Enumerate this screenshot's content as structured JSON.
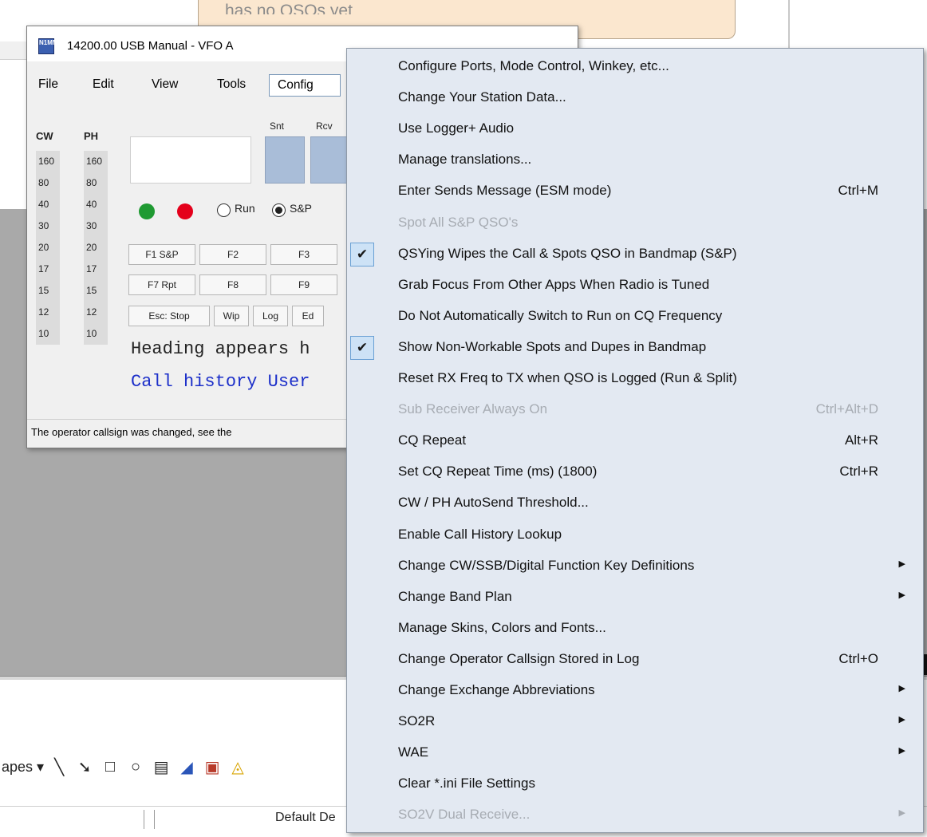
{
  "background": {
    "note_text": "has no QSOs yet",
    "draw_toolbar_label": "apes",
    "status_text": "Default De"
  },
  "entry_window": {
    "logo_text": "N1MM",
    "title": "14200.00 USB Manual - VFO A",
    "menus": [
      "File",
      "Edit",
      "View",
      "Tools",
      "Config"
    ],
    "band_headers": [
      "CW",
      "PH"
    ],
    "bands": [
      "160",
      "80",
      "40",
      "30",
      "20",
      "17",
      "15",
      "12",
      "10"
    ],
    "snt_label": "Snt",
    "rcv_label": "Rcv",
    "run_label": "Run",
    "sp_label": "S&P",
    "fkeys_row1": [
      "F1 S&P",
      "F2",
      "F3"
    ],
    "fkeys_row2": [
      "F7 Rpt",
      "F8",
      "F9"
    ],
    "fkeys_row3": [
      "Esc: Stop",
      "Wip",
      "Log",
      "Ed"
    ],
    "heading_text": "Heading appears h",
    "call_history_text": "Call history User",
    "status_text": "The operator callsign was changed, see the"
  },
  "config_menu": {
    "items": [
      {
        "label": "Configure Ports, Mode Control, Winkey, etc...",
        "shortcut": "",
        "checked": false,
        "disabled": false,
        "submenu": false
      },
      {
        "label": "Change Your Station Data...",
        "shortcut": "",
        "checked": false,
        "disabled": false,
        "submenu": false
      },
      {
        "label": "Use Logger+ Audio",
        "shortcut": "",
        "checked": false,
        "disabled": false,
        "submenu": false
      },
      {
        "label": "Manage translations...",
        "shortcut": "",
        "checked": false,
        "disabled": false,
        "submenu": false
      },
      {
        "label": "Enter Sends Message (ESM mode)",
        "shortcut": "Ctrl+M",
        "checked": false,
        "disabled": false,
        "submenu": false
      },
      {
        "label": "Spot All S&P QSO's",
        "shortcut": "",
        "checked": false,
        "disabled": true,
        "submenu": false
      },
      {
        "label": "QSYing Wipes the Call & Spots QSO in Bandmap (S&P)",
        "shortcut": "",
        "checked": true,
        "disabled": false,
        "submenu": false
      },
      {
        "label": "Grab Focus From Other Apps When Radio is Tuned",
        "shortcut": "",
        "checked": false,
        "disabled": false,
        "submenu": false
      },
      {
        "label": "Do Not Automatically Switch to Run on CQ Frequency",
        "shortcut": "",
        "checked": false,
        "disabled": false,
        "submenu": false
      },
      {
        "label": "Show Non-Workable Spots and Dupes in Bandmap",
        "shortcut": "",
        "checked": true,
        "disabled": false,
        "submenu": false
      },
      {
        "label": "Reset RX Freq to TX when QSO is Logged (Run & Split)",
        "shortcut": "",
        "checked": false,
        "disabled": false,
        "submenu": false
      },
      {
        "label": "Sub Receiver Always On",
        "shortcut": "Ctrl+Alt+D",
        "checked": false,
        "disabled": true,
        "submenu": false
      },
      {
        "label": "CQ Repeat",
        "shortcut": "Alt+R",
        "checked": false,
        "disabled": false,
        "submenu": false
      },
      {
        "label": "Set CQ Repeat Time (ms) (1800)",
        "shortcut": "Ctrl+R",
        "checked": false,
        "disabled": false,
        "submenu": false
      },
      {
        "label": "CW / PH AutoSend Threshold...",
        "shortcut": "",
        "checked": false,
        "disabled": false,
        "submenu": false
      },
      {
        "label": "Enable Call History Lookup",
        "shortcut": "",
        "checked": false,
        "disabled": false,
        "submenu": false
      },
      {
        "label": "Change CW/SSB/Digital Function Key Definitions",
        "shortcut": "",
        "checked": false,
        "disabled": false,
        "submenu": true
      },
      {
        "label": "Change Band Plan",
        "shortcut": "",
        "checked": false,
        "disabled": false,
        "submenu": true
      },
      {
        "label": "Manage Skins, Colors and Fonts...",
        "shortcut": "",
        "checked": false,
        "disabled": false,
        "submenu": false
      },
      {
        "label": "Change Operator Callsign Stored in Log",
        "shortcut": "Ctrl+O",
        "checked": false,
        "disabled": false,
        "submenu": false
      },
      {
        "label": "Change Exchange Abbreviations",
        "shortcut": "",
        "checked": false,
        "disabled": false,
        "submenu": true
      },
      {
        "label": "SO2R",
        "shortcut": "",
        "checked": false,
        "disabled": false,
        "submenu": true
      },
      {
        "label": "WAE",
        "shortcut": "",
        "checked": false,
        "disabled": false,
        "submenu": true
      },
      {
        "label": "Clear *.ini File Settings",
        "shortcut": "",
        "checked": false,
        "disabled": false,
        "submenu": false
      },
      {
        "label": "SO2V Dual Receive...",
        "shortcut": "",
        "checked": false,
        "disabled": true,
        "submenu": true
      }
    ],
    "check_glyph": "✔",
    "submenu_glyph": "▶"
  }
}
